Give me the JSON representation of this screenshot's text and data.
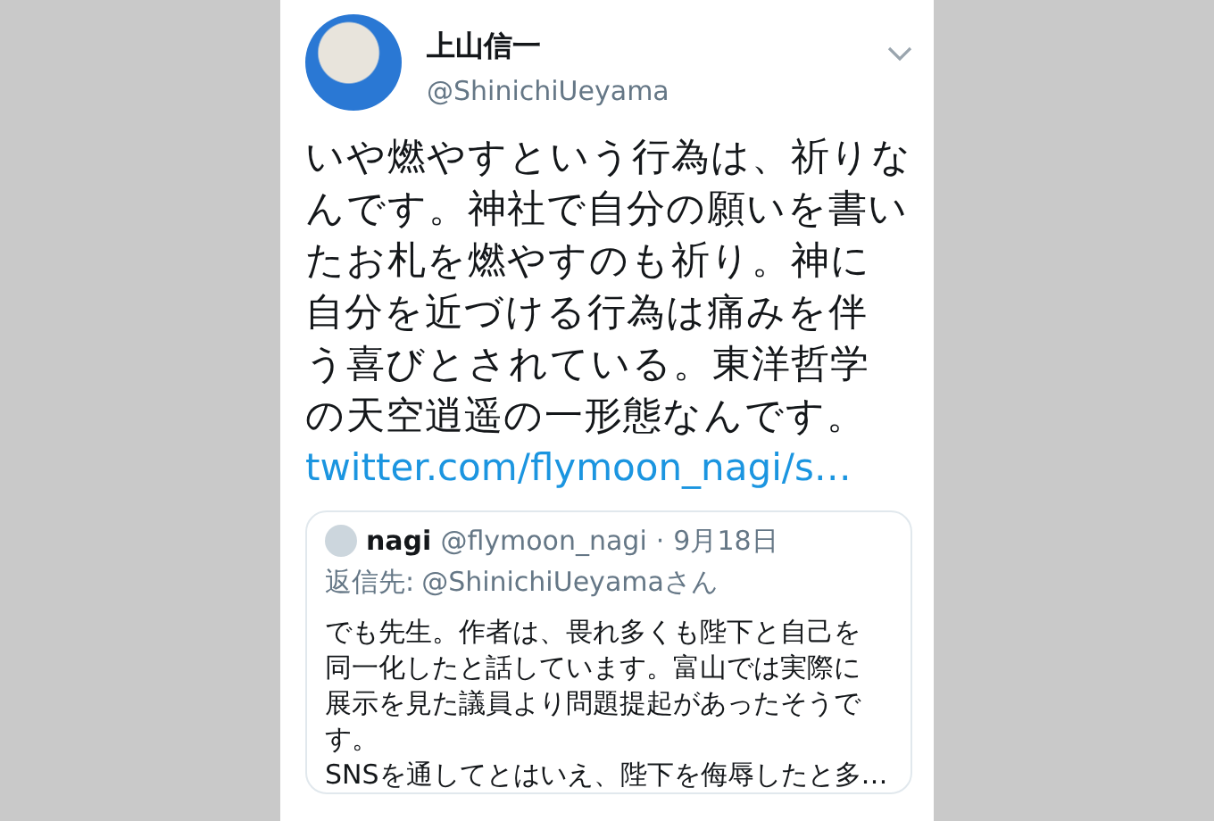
{
  "tweet": {
    "author": {
      "name": "上山信一",
      "handle": "@ShinichiUeyama"
    },
    "body_lines": [
      "いや燃やすという行為は、祈りな",
      "んです。神社で自分の願いを書い",
      "たお札を燃やすのも祈り。神に",
      "自分を近づける行為は痛みを伴",
      "う喜びとされている。東洋哲学",
      "の天空逍遥の一形態なんです。"
    ],
    "link": "twitter.com/flymoon_nagi/s…",
    "quoted": {
      "name": "nagi",
      "handle": "@flymoon_nagi",
      "separator": "·",
      "date": "9月18日",
      "reply_label": "返信先:",
      "reply_to": "@ShinichiUeyamaさん",
      "body_lines": [
        "でも先生。作者は、畏れ多くも陛下と自己を",
        "同一化したと話しています。富山では実際に",
        "展示を見た議員より問題提起があったそうで",
        "す。",
        "SNSを通してとはいえ、陛下を侮辱したと多…"
      ]
    }
  }
}
